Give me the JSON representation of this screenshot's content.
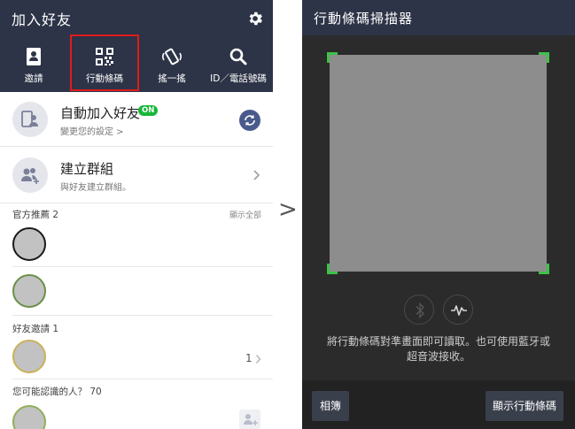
{
  "left": {
    "title": "加入好友",
    "tabs": [
      {
        "label": "邀請",
        "icon": "contact-book-icon"
      },
      {
        "label": "行動條碼",
        "icon": "qr-code-icon"
      },
      {
        "label": "搖一搖",
        "icon": "shake-phone-icon"
      },
      {
        "label": "ID／電話號碼",
        "icon": "search-icon"
      }
    ],
    "auto_add": {
      "title": "自動加入好友",
      "badge": "ON",
      "subtitle": "變更您的設定 >"
    },
    "create_group": {
      "title": "建立群組",
      "subtitle": "與好友建立群組。"
    },
    "official": {
      "label": "官方推薦 2",
      "show_all": "顯示全部"
    },
    "invites": {
      "label": "好友邀請 1",
      "count": "1"
    },
    "maybe_know": {
      "label": "您可能認識的人？ 70"
    }
  },
  "arrow": ">",
  "right": {
    "title": "行動條碼掃描器",
    "help_line1": "將行動條碼對準畫面即可讀取。也可使用藍牙或",
    "help_line2": "超音波接收。",
    "album_button": "相簿",
    "show_code_button": "顯示行動條碼"
  },
  "colors": {
    "header": "#2d3447",
    "accent_green": "#3cc247",
    "badge_green": "#19b638",
    "highlight_red": "#e01b1b"
  }
}
